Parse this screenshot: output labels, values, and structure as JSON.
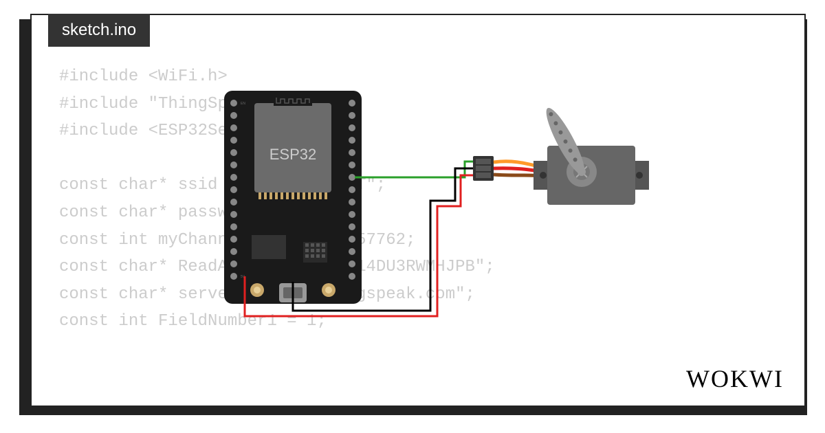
{
  "tab": {
    "filename": "sketch.ino"
  },
  "code": {
    "lines": [
      "#include <WiFi.h>",
      "#include \"ThingSpeak.h\"",
      "#include <ESP32Servo.h>",
      "",
      "const char* ssid = \"Wokwi-GUEST\";",
      "const char* password = \"\";",
      "const int myChannelNumber = 2557762;",
      "const char* ReadAPIKey = \"520114DU3RWMHJPB\";",
      "const char* server = \"api.thingspeak.com\";",
      "const int FieldNumber1 = 1;"
    ]
  },
  "board": {
    "label": "ESP32"
  },
  "branding": {
    "name": "WOKWI"
  },
  "circuit": {
    "components": [
      "esp32-devkit",
      "servo-motor"
    ],
    "wires": [
      {
        "color": "green",
        "from": "esp32-gpio",
        "to": "servo-signal"
      },
      {
        "color": "red",
        "from": "esp32-5v",
        "to": "servo-vcc"
      },
      {
        "color": "black",
        "from": "esp32-gnd",
        "to": "servo-gnd"
      }
    ]
  }
}
